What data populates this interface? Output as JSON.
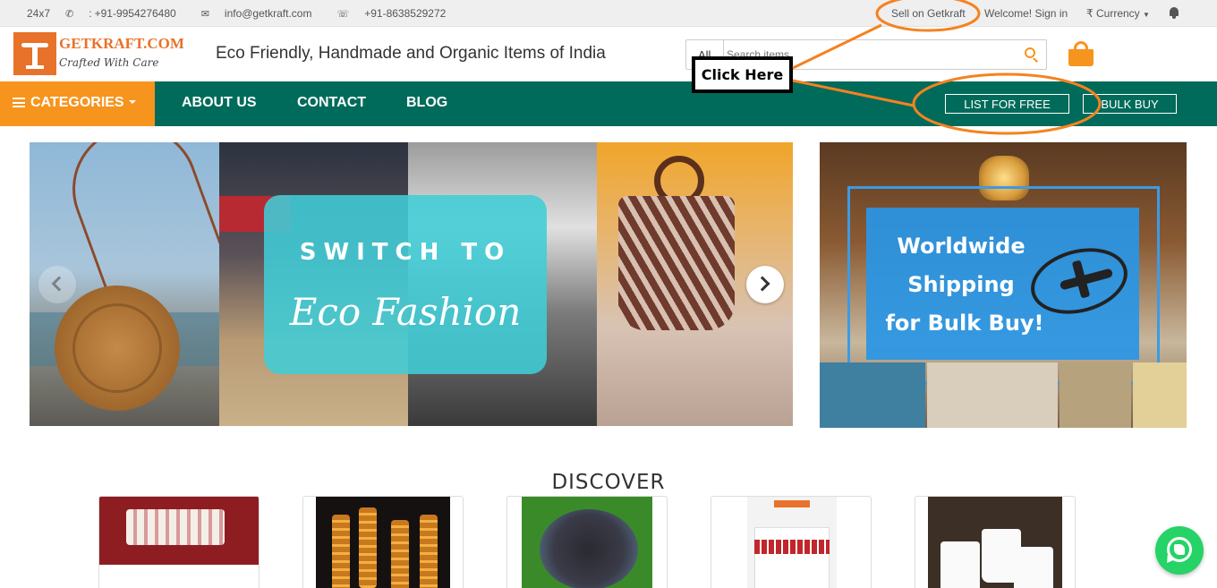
{
  "topbar": {
    "support_hours": "24x7",
    "phone": "+91-9954276480",
    "email": "info@getkraft.com",
    "whatsapp_number": "+91-8638529272",
    "sell_link": "Sell on Getkraft",
    "welcome": "Welcome! Sign in",
    "currency_symbol": "₹",
    "currency": "Currency"
  },
  "header": {
    "logo_name": "GETKRAFT.COM",
    "logo_tagline": "Crafted With Care",
    "tagline": "Eco Friendly, Handmade and Organic Items of India",
    "search_category": "All",
    "search_placeholder": "Search items"
  },
  "annotation": {
    "label": "Click Here",
    "color": "#f58220"
  },
  "nav": {
    "categories": "CATEGORIES",
    "about": "ABOUT US",
    "contact": "CONTACT",
    "blog": "BLOG",
    "list_free": "LIST FOR FREE",
    "bulk_buy": "BULK BUY"
  },
  "hero": {
    "line1": "SWITCH TO",
    "line2": "Eco Fashion"
  },
  "side_banner": {
    "line1": "Worldwide",
    "line2": "Shipping",
    "line3": "for Bulk Buy!"
  },
  "discover": {
    "title": "DISCOVER"
  },
  "colors": {
    "accent": "#f7941d",
    "nav_bg": "#006b5a",
    "whatsapp": "#25d366"
  }
}
